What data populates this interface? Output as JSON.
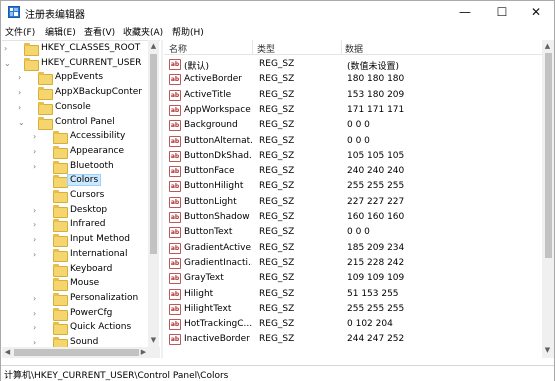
{
  "window": {
    "title": "注册表编辑器",
    "controls": {
      "minimize": "—",
      "maximize": "☐",
      "close": "✕"
    }
  },
  "menu": [
    "文件(F)",
    "编辑(E)",
    "查看(V)",
    "收藏夹(A)",
    "帮助(H)"
  ],
  "tree": [
    {
      "label": "HKEY_CLASSES_ROOT",
      "level": 0,
      "expander": ">"
    },
    {
      "label": "HKEY_CURRENT_USER",
      "level": 0,
      "expander": "v"
    },
    {
      "label": "AppEvents",
      "level": 1,
      "expander": ">"
    },
    {
      "label": "AppXBackupConter",
      "level": 1,
      "expander": ">"
    },
    {
      "label": "Console",
      "level": 1,
      "expander": ">"
    },
    {
      "label": "Control Panel",
      "level": 1,
      "expander": "v"
    },
    {
      "label": "Accessibility",
      "level": 2,
      "expander": ">"
    },
    {
      "label": "Appearance",
      "level": 2,
      "expander": ">"
    },
    {
      "label": "Bluetooth",
      "level": 2,
      "expander": ">"
    },
    {
      "label": "Colors",
      "level": 2,
      "expander": "",
      "selected": true
    },
    {
      "label": "Cursors",
      "level": 2,
      "expander": ""
    },
    {
      "label": "Desktop",
      "level": 2,
      "expander": ">"
    },
    {
      "label": "Infrared",
      "level": 2,
      "expander": ">"
    },
    {
      "label": "Input Method",
      "level": 2,
      "expander": ">"
    },
    {
      "label": "International",
      "level": 2,
      "expander": ">"
    },
    {
      "label": "Keyboard",
      "level": 2,
      "expander": ""
    },
    {
      "label": "Mouse",
      "level": 2,
      "expander": ""
    },
    {
      "label": "Personalization",
      "level": 2,
      "expander": ">"
    },
    {
      "label": "PowerCfg",
      "level": 2,
      "expander": ">"
    },
    {
      "label": "Quick Actions",
      "level": 2,
      "expander": ">"
    },
    {
      "label": "Sound",
      "level": 2,
      "expander": ">"
    }
  ],
  "list": {
    "headers": {
      "name": "名称",
      "type": "类型",
      "data": "数据"
    },
    "rows": [
      {
        "name": "(默认)",
        "type": "REG_SZ",
        "data": "(数值未设置)"
      },
      {
        "name": "ActiveBorder",
        "type": "REG_SZ",
        "data": "180 180 180"
      },
      {
        "name": "ActiveTitle",
        "type": "REG_SZ",
        "data": "153 180 209"
      },
      {
        "name": "AppWorkspace",
        "type": "REG_SZ",
        "data": "171 171 171"
      },
      {
        "name": "Background",
        "type": "REG_SZ",
        "data": "0 0 0"
      },
      {
        "name": "ButtonAlternat...",
        "type": "REG_SZ",
        "data": "0 0 0"
      },
      {
        "name": "ButtonDkShad...",
        "type": "REG_SZ",
        "data": "105 105 105"
      },
      {
        "name": "ButtonFace",
        "type": "REG_SZ",
        "data": "240 240 240"
      },
      {
        "name": "ButtonHilight",
        "type": "REG_SZ",
        "data": "255 255 255"
      },
      {
        "name": "ButtonLight",
        "type": "REG_SZ",
        "data": "227 227 227"
      },
      {
        "name": "ButtonShadow",
        "type": "REG_SZ",
        "data": "160 160 160"
      },
      {
        "name": "ButtonText",
        "type": "REG_SZ",
        "data": "0 0 0"
      },
      {
        "name": "GradientActive...",
        "type": "REG_SZ",
        "data": "185 209 234"
      },
      {
        "name": "GradientInacti...",
        "type": "REG_SZ",
        "data": "215 228 242"
      },
      {
        "name": "GrayText",
        "type": "REG_SZ",
        "data": "109 109 109"
      },
      {
        "name": "Hilight",
        "type": "REG_SZ",
        "data": "51 153 255"
      },
      {
        "name": "HilightText",
        "type": "REG_SZ",
        "data": "255 255 255"
      },
      {
        "name": "HotTrackingC...",
        "type": "REG_SZ",
        "data": "0 102 204"
      },
      {
        "name": "InactiveBorder",
        "type": "REG_SZ",
        "data": "244 247 252"
      }
    ]
  },
  "status": "计算机\\HKEY_CURRENT_USER\\Control Panel\\Colors",
  "colors": {
    "selection": "#cce8ff",
    "folder": "#f5d56d",
    "string_icon": "#b03030"
  }
}
